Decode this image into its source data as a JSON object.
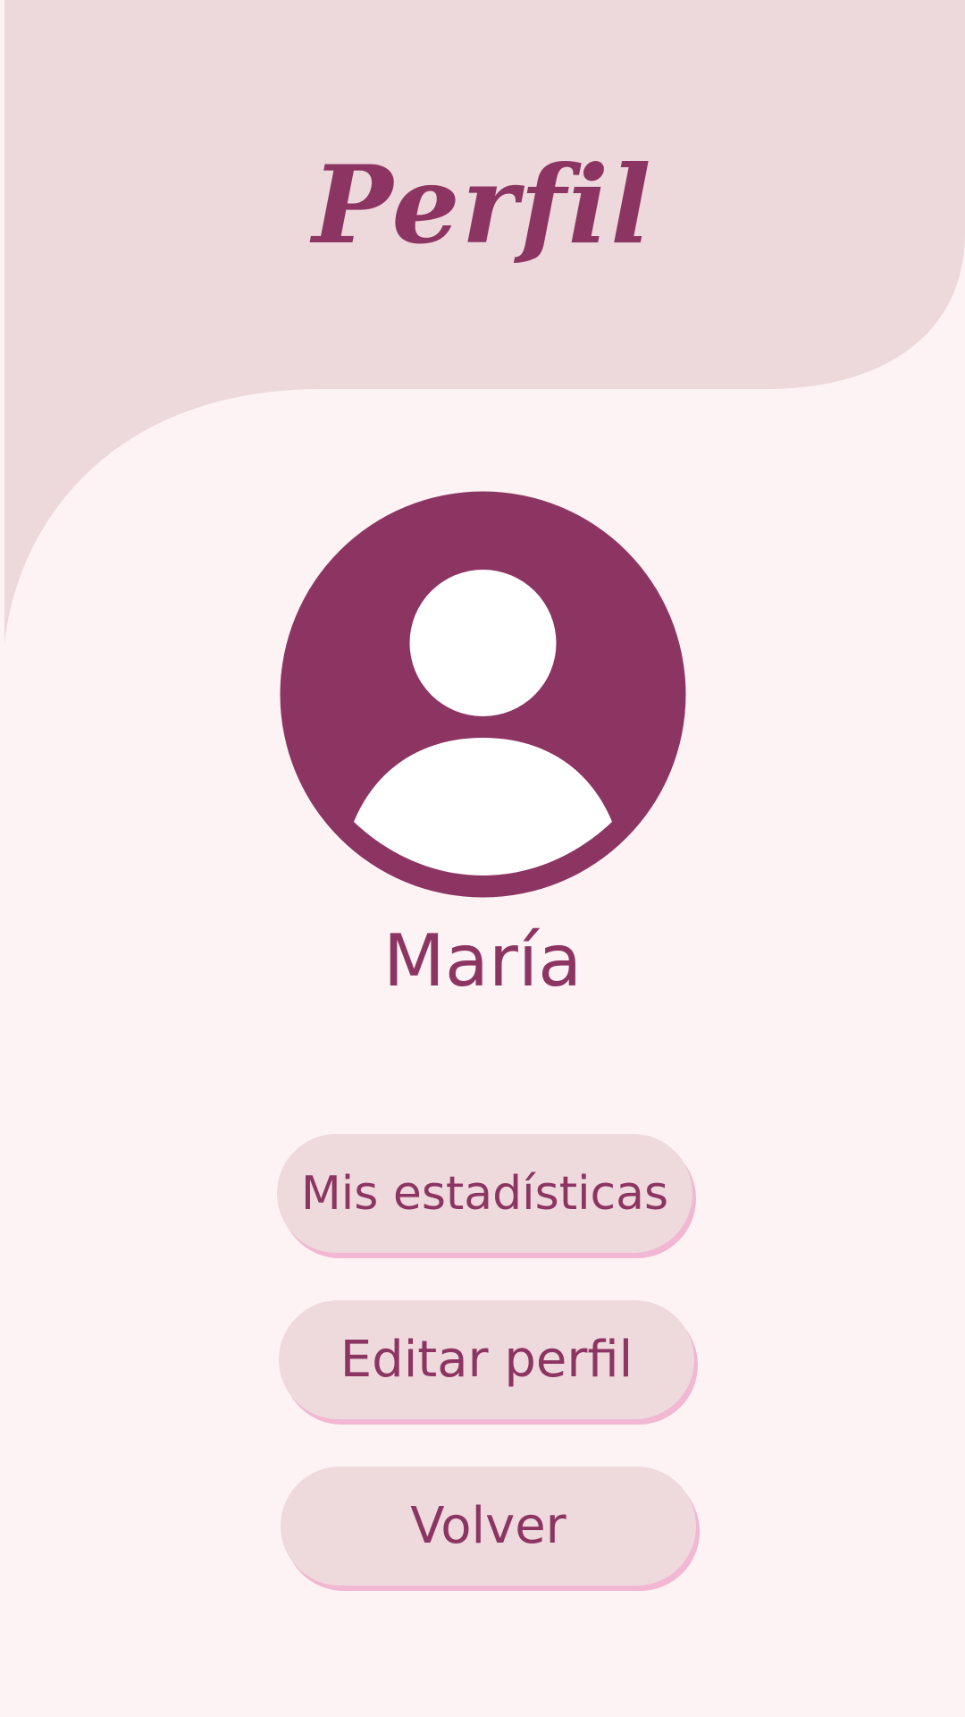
{
  "header": {
    "title": "Perfil"
  },
  "profile": {
    "avatar_icon": "user-avatar-icon",
    "name": "María"
  },
  "actions": {
    "stats_label": "Mis estadísticas",
    "edit_label": "Editar perfil",
    "back_label": "Volver"
  },
  "colors": {
    "background": "#fdf3f4",
    "header_shape": "#edd9dc",
    "accent": "#8d3562",
    "button_bg": "#eed9dd",
    "button_shadow": "#f2b7d2"
  }
}
